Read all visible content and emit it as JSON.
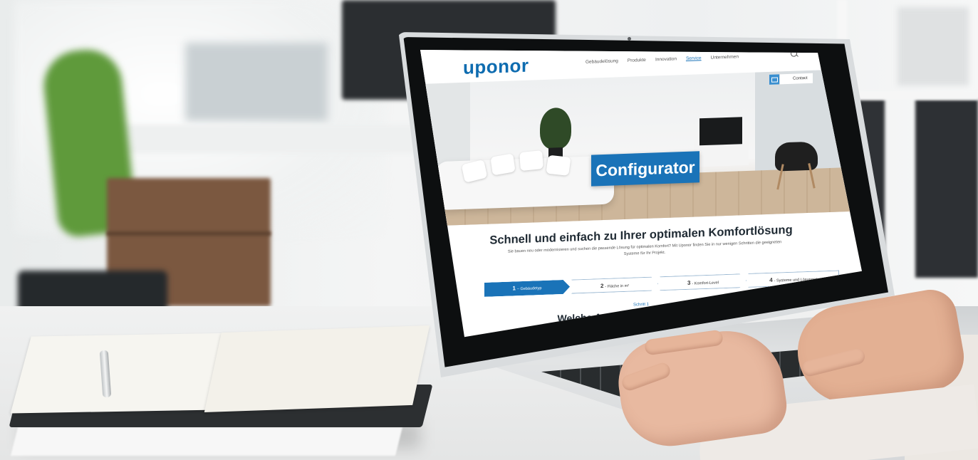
{
  "site": {
    "logo": "uponor",
    "nav": [
      "Gebäudelösung",
      "Produkte",
      "Innovation",
      "Service",
      "Unternehmen"
    ],
    "nav_active": "Service",
    "contact_label": "Contact",
    "hero_badge": "Configurator",
    "headline": "Schnell und einfach zu Ihrer optimalen Komfortlösung",
    "subline": "Sie bauen neu oder modernisieren und suchen die passende Lösung für optimalen Komfort? Mit Uponor finden Sie in nur wenigen Schritten die geeigneten Systeme für Ihr Projekt.",
    "steps": [
      {
        "num": "1",
        "label": "– Gebäudetyp"
      },
      {
        "num": "2",
        "label": "- Fläche in m²"
      },
      {
        "num": "3",
        "label": "- Komfort-Level"
      },
      {
        "num": "4",
        "label": "- Systeme und Lösungen"
      }
    ],
    "step_caption": "Schritt 1",
    "question": "Welche Art von Projekt planen Sie?"
  },
  "colors": {
    "brand_blue": "#1a73b8",
    "background": "#f3f4f5"
  }
}
